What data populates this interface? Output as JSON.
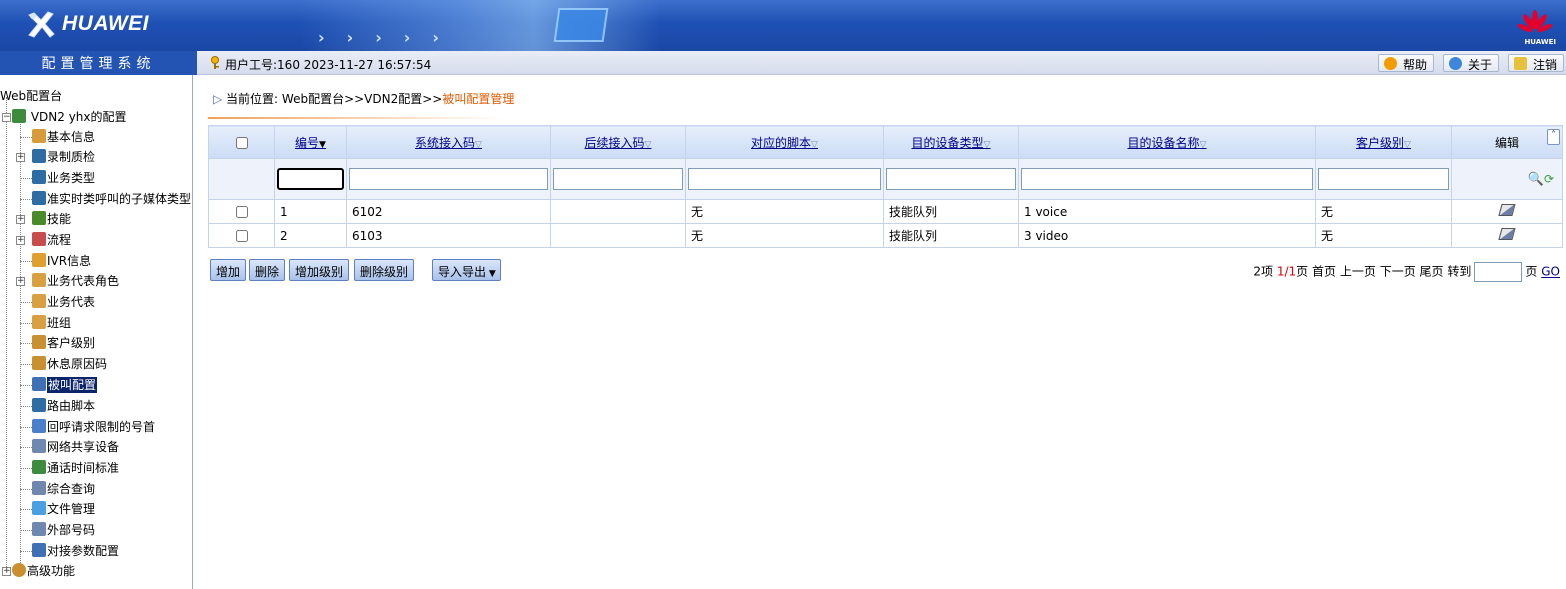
{
  "header": {
    "brand": "HUAWEI",
    "system_title": "配置管理系统",
    "brand_small": "HUAWEI",
    "user_info": "用户工号:160   2023-11-27 16:57:54",
    "buttons": {
      "help": "帮助",
      "about": "关于",
      "logout": "注销"
    }
  },
  "sidebar": {
    "root": "Web配置台",
    "vdn": "VDN2 yhx的配置",
    "items": [
      "基本信息",
      "录制质检",
      "业务类型",
      "准实时类呼叫的子媒体类型",
      "技能",
      "流程",
      "IVR信息",
      "业务代表角色",
      "业务代表",
      "班组",
      "客户级别",
      "休息原因码",
      "被叫配置",
      "路由脚本",
      "回呼请求限制的号首",
      "网络共享设备",
      "通话时间标准",
      "综合查询",
      "文件管理",
      "外部号码",
      "对接参数配置"
    ],
    "advanced": "高级功能"
  },
  "breadcrumb": {
    "prefix": "当前位置: Web配置台>>VDN2配置>>",
    "current": "被叫配置管理"
  },
  "table": {
    "headers": [
      "编号",
      "系统接入码",
      "后续接入码",
      "对应的脚本",
      "目的设备类型",
      "目的设备名称",
      "客户级别",
      "编辑"
    ],
    "rows": [
      [
        "1",
        "6102",
        "",
        "无",
        "技能队列",
        "1 voice",
        "无"
      ],
      [
        "2",
        "6103",
        "",
        "无",
        "技能队列",
        "3 video",
        "无"
      ]
    ]
  },
  "toolbar": {
    "add": "增加",
    "delete": "删除",
    "add_level": "增加级别",
    "delete_level": "删除级别",
    "import_export": "导入导出"
  },
  "pager": {
    "items": "2项",
    "page": "1/1",
    "page_unit": "页",
    "first": "首页",
    "prev": "上一页",
    "next": "下一页",
    "last": "尾页",
    "goto": "转到",
    "page_label": "页",
    "go": "GO"
  },
  "colors": {
    "accent": "#1f51b5",
    "breadcrumb_current": "#e05a00",
    "selected": "#0a246a"
  }
}
